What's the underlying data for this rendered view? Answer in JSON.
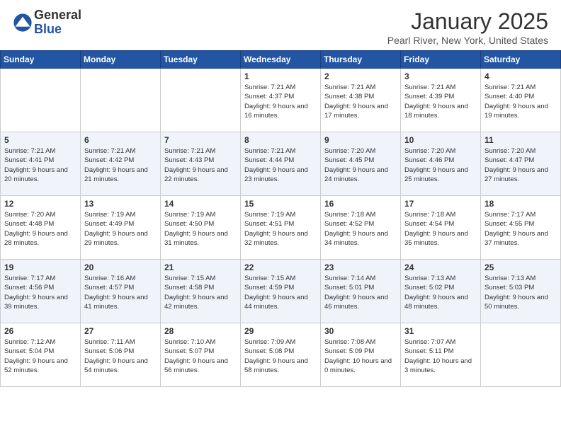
{
  "header": {
    "logo_general": "General",
    "logo_blue": "Blue",
    "title": "January 2025",
    "location": "Pearl River, New York, United States"
  },
  "days_of_week": [
    "Sunday",
    "Monday",
    "Tuesday",
    "Wednesday",
    "Thursday",
    "Friday",
    "Saturday"
  ],
  "weeks": [
    [
      {
        "day": "",
        "info": ""
      },
      {
        "day": "",
        "info": ""
      },
      {
        "day": "",
        "info": ""
      },
      {
        "day": "1",
        "info": "Sunrise: 7:21 AM\nSunset: 4:37 PM\nDaylight: 9 hours and 16 minutes."
      },
      {
        "day": "2",
        "info": "Sunrise: 7:21 AM\nSunset: 4:38 PM\nDaylight: 9 hours and 17 minutes."
      },
      {
        "day": "3",
        "info": "Sunrise: 7:21 AM\nSunset: 4:39 PM\nDaylight: 9 hours and 18 minutes."
      },
      {
        "day": "4",
        "info": "Sunrise: 7:21 AM\nSunset: 4:40 PM\nDaylight: 9 hours and 19 minutes."
      }
    ],
    [
      {
        "day": "5",
        "info": "Sunrise: 7:21 AM\nSunset: 4:41 PM\nDaylight: 9 hours and 20 minutes."
      },
      {
        "day": "6",
        "info": "Sunrise: 7:21 AM\nSunset: 4:42 PM\nDaylight: 9 hours and 21 minutes."
      },
      {
        "day": "7",
        "info": "Sunrise: 7:21 AM\nSunset: 4:43 PM\nDaylight: 9 hours and 22 minutes."
      },
      {
        "day": "8",
        "info": "Sunrise: 7:21 AM\nSunset: 4:44 PM\nDaylight: 9 hours and 23 minutes."
      },
      {
        "day": "9",
        "info": "Sunrise: 7:20 AM\nSunset: 4:45 PM\nDaylight: 9 hours and 24 minutes."
      },
      {
        "day": "10",
        "info": "Sunrise: 7:20 AM\nSunset: 4:46 PM\nDaylight: 9 hours and 25 minutes."
      },
      {
        "day": "11",
        "info": "Sunrise: 7:20 AM\nSunset: 4:47 PM\nDaylight: 9 hours and 27 minutes."
      }
    ],
    [
      {
        "day": "12",
        "info": "Sunrise: 7:20 AM\nSunset: 4:48 PM\nDaylight: 9 hours and 28 minutes."
      },
      {
        "day": "13",
        "info": "Sunrise: 7:19 AM\nSunset: 4:49 PM\nDaylight: 9 hours and 29 minutes."
      },
      {
        "day": "14",
        "info": "Sunrise: 7:19 AM\nSunset: 4:50 PM\nDaylight: 9 hours and 31 minutes."
      },
      {
        "day": "15",
        "info": "Sunrise: 7:19 AM\nSunset: 4:51 PM\nDaylight: 9 hours and 32 minutes."
      },
      {
        "day": "16",
        "info": "Sunrise: 7:18 AM\nSunset: 4:52 PM\nDaylight: 9 hours and 34 minutes."
      },
      {
        "day": "17",
        "info": "Sunrise: 7:18 AM\nSunset: 4:54 PM\nDaylight: 9 hours and 35 minutes."
      },
      {
        "day": "18",
        "info": "Sunrise: 7:17 AM\nSunset: 4:55 PM\nDaylight: 9 hours and 37 minutes."
      }
    ],
    [
      {
        "day": "19",
        "info": "Sunrise: 7:17 AM\nSunset: 4:56 PM\nDaylight: 9 hours and 39 minutes."
      },
      {
        "day": "20",
        "info": "Sunrise: 7:16 AM\nSunset: 4:57 PM\nDaylight: 9 hours and 41 minutes."
      },
      {
        "day": "21",
        "info": "Sunrise: 7:15 AM\nSunset: 4:58 PM\nDaylight: 9 hours and 42 minutes."
      },
      {
        "day": "22",
        "info": "Sunrise: 7:15 AM\nSunset: 4:59 PM\nDaylight: 9 hours and 44 minutes."
      },
      {
        "day": "23",
        "info": "Sunrise: 7:14 AM\nSunset: 5:01 PM\nDaylight: 9 hours and 46 minutes."
      },
      {
        "day": "24",
        "info": "Sunrise: 7:13 AM\nSunset: 5:02 PM\nDaylight: 9 hours and 48 minutes."
      },
      {
        "day": "25",
        "info": "Sunrise: 7:13 AM\nSunset: 5:03 PM\nDaylight: 9 hours and 50 minutes."
      }
    ],
    [
      {
        "day": "26",
        "info": "Sunrise: 7:12 AM\nSunset: 5:04 PM\nDaylight: 9 hours and 52 minutes."
      },
      {
        "day": "27",
        "info": "Sunrise: 7:11 AM\nSunset: 5:06 PM\nDaylight: 9 hours and 54 minutes."
      },
      {
        "day": "28",
        "info": "Sunrise: 7:10 AM\nSunset: 5:07 PM\nDaylight: 9 hours and 56 minutes."
      },
      {
        "day": "29",
        "info": "Sunrise: 7:09 AM\nSunset: 5:08 PM\nDaylight: 9 hours and 58 minutes."
      },
      {
        "day": "30",
        "info": "Sunrise: 7:08 AM\nSunset: 5:09 PM\nDaylight: 10 hours and 0 minutes."
      },
      {
        "day": "31",
        "info": "Sunrise: 7:07 AM\nSunset: 5:11 PM\nDaylight: 10 hours and 3 minutes."
      },
      {
        "day": "",
        "info": ""
      }
    ]
  ]
}
